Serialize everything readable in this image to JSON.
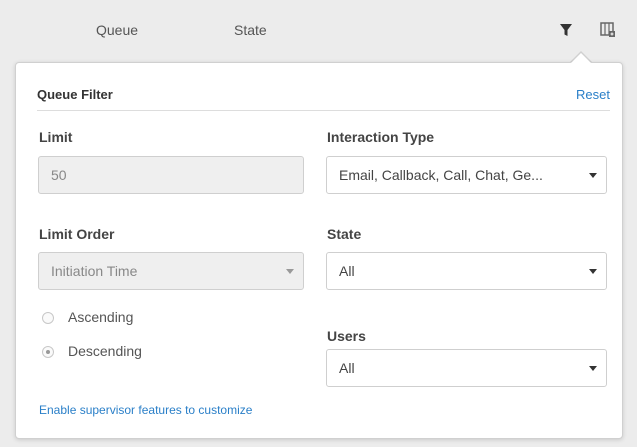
{
  "header": {
    "columns": [
      "Queue",
      "State"
    ],
    "filter_icon": "filter-icon",
    "column_chooser_icon": "column-chooser-icon"
  },
  "panel": {
    "title": "Queue Filter",
    "reset_label": "Reset",
    "limit": {
      "label": "Limit",
      "value": "50"
    },
    "interaction_type": {
      "label": "Interaction Type",
      "value": "Email, Callback, Call, Chat, Ge..."
    },
    "limit_order": {
      "label": "Limit Order",
      "value": "Initiation Time"
    },
    "state": {
      "label": "State",
      "value": "All"
    },
    "users": {
      "label": "Users",
      "value": "All"
    },
    "order_options": [
      {
        "label": "Ascending",
        "selected": false
      },
      {
        "label": "Descending",
        "selected": true
      }
    ],
    "supervisor_link": "Enable supervisor features to customize"
  },
  "colors": {
    "link": "#2a7fc8",
    "background": "#ececec",
    "panel": "#ffffff"
  }
}
